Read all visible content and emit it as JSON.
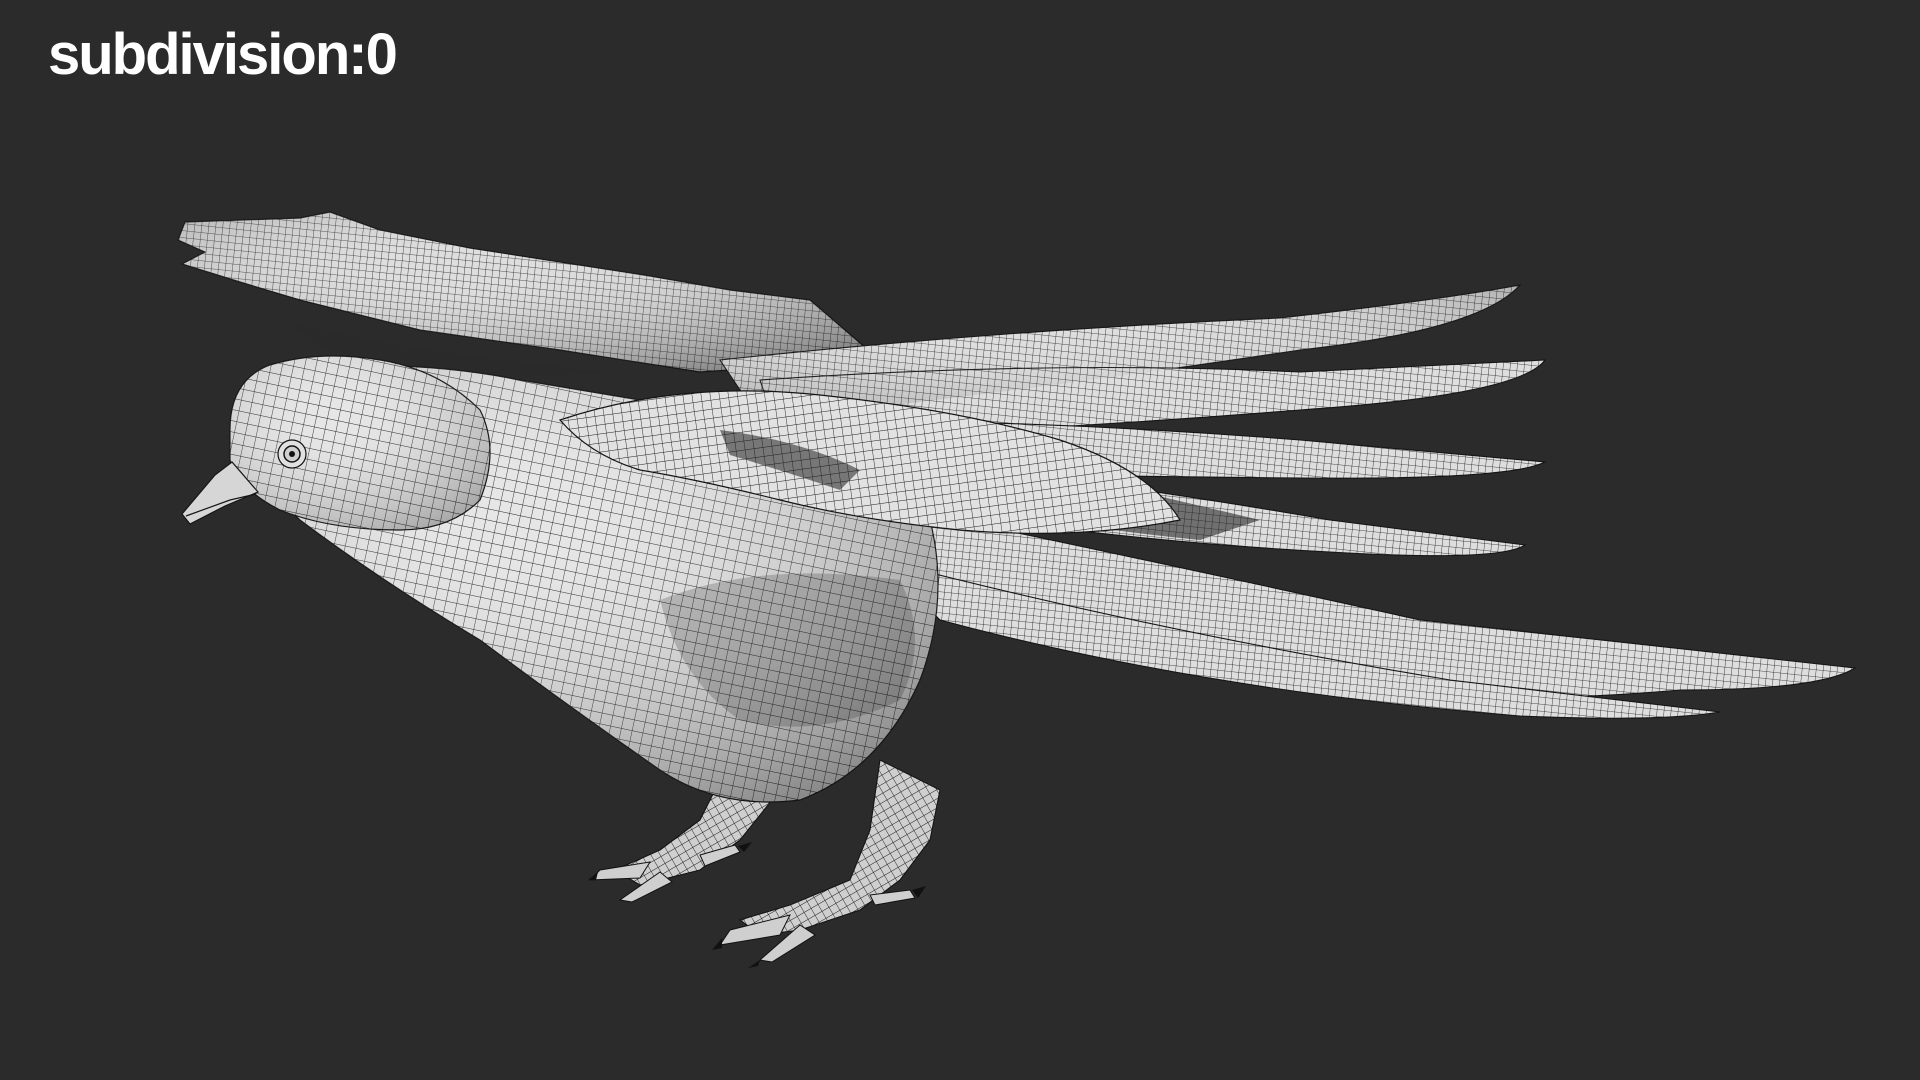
{
  "viewport": {
    "caption": "subdivision:0"
  },
  "colors": {
    "background": "#2b2b2b",
    "caption": "#ffffff",
    "model_surface": "#e4e4e4",
    "wireframe": "#1a1a1a"
  }
}
